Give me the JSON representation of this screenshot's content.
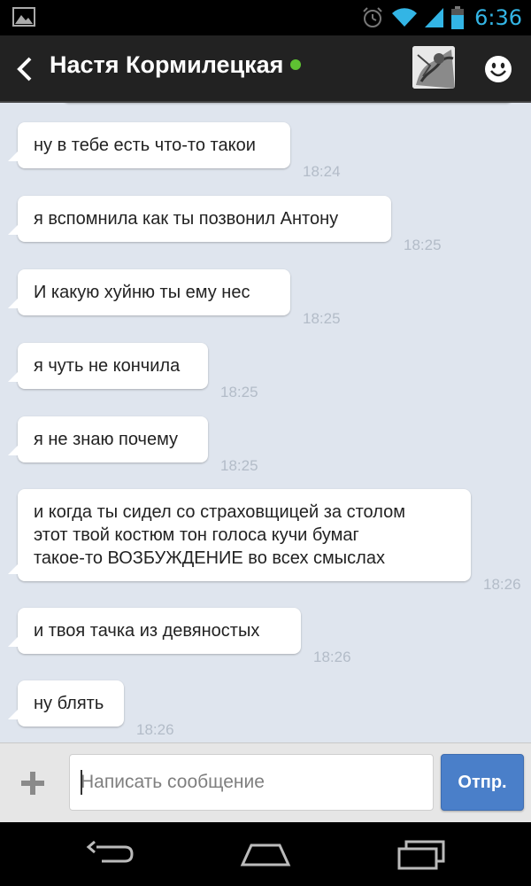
{
  "status_bar": {
    "time": "6:36",
    "icons": [
      "gallery-notification-icon",
      "alarm-icon",
      "wifi-icon",
      "signal-icon",
      "battery-icon"
    ]
  },
  "header": {
    "contact_name": "Настя Кормилецкая",
    "online": true
  },
  "messages": [
    {
      "text": "ну в тебе есть что-то такои",
      "time": "18:24"
    },
    {
      "text": "я вспомнила как ты позвонил Антону",
      "time": "18:25"
    },
    {
      "text": "И какую хуйню ты ему нес",
      "time": "18:25"
    },
    {
      "text": "я чуть не кончила",
      "time": "18:25"
    },
    {
      "text": "я не знаю почему",
      "time": "18:25"
    },
    {
      "text": "и когда ты сидел со страховщицей за столом\nэтот твой костюм тон голоса кучи бумаг\nтакое-то ВОЗБУЖДЕНИЕ во всех смыслах",
      "time": "18:26"
    },
    {
      "text": "и твоя тачка из девяностых",
      "time": "18:26"
    },
    {
      "text": "ну блять",
      "time": "18:26"
    }
  ],
  "composer": {
    "placeholder": "Написать сообщение",
    "value": "",
    "send_label": "Отпр."
  },
  "colors": {
    "accent": "#33b5e5",
    "send_button": "#4a7fc9",
    "online": "#5ec232",
    "chat_background": "#dfe5ee"
  }
}
